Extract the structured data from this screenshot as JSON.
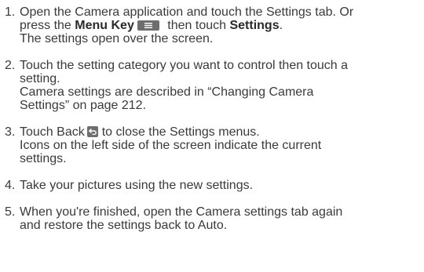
{
  "steps": [
    {
      "number": "1.",
      "line1_text": "Open the Camera application and touch the Settings tab. Or",
      "line2_pre": "press the ",
      "line2_bold1": "Menu Key",
      "line2_mid": " then touch ",
      "line2_bold2": "Settings",
      "line2_end": ".",
      "line3_text": "The settings open over the screen."
    },
    {
      "number": "2.",
      "line1_text": "Touch the setting category you want to control then touch a",
      "line2_text": "setting.",
      "line3_text": "Camera settings are described in “Changing Camera",
      "line4_text": "Settings” on page 212."
    },
    {
      "number": "3.",
      "line1_pre": "Touch Back",
      "line1_post": "to close the Settings menus.",
      "line2_text": "Icons on the left side of the screen indicate the current",
      "line3_text": "settings."
    },
    {
      "number": "4.",
      "line1_text": "Take your pictures using the new settings."
    },
    {
      "number": "5.",
      "line1_text": "When you're finished, open the Camera settings tab again",
      "line2_text": "and restore the settings back to Auto."
    }
  ],
  "icons": {
    "menu_key": "menu-key-icon",
    "back_key": "back-key-icon"
  },
  "colors": {
    "text": "#3a3a3a",
    "icon_bg": "#6e6e6e"
  }
}
